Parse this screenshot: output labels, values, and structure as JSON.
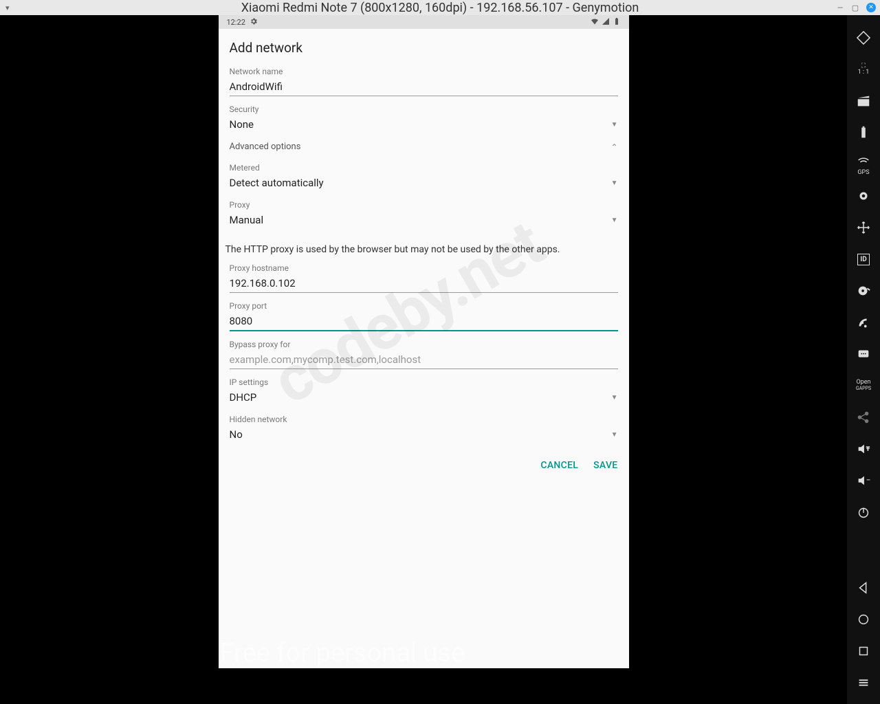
{
  "window": {
    "title": "Xiaomi Redmi Note 7 (800x1280, 160dpi) - 192.168.56.107 - Genymotion"
  },
  "statusbar": {
    "time": "12:22"
  },
  "page": {
    "title": "Add network",
    "network_name_label": "Network name",
    "network_name_value": "AndroidWifi",
    "security_label": "Security",
    "security_value": "None",
    "advanced_label": "Advanced options",
    "metered_label": "Metered",
    "metered_value": "Detect automatically",
    "proxy_label": "Proxy",
    "proxy_value": "Manual",
    "proxy_info": "The HTTP proxy is used by the browser but may not be used by the other apps.",
    "proxy_host_label": "Proxy hostname",
    "proxy_host_value": "192.168.0.102",
    "proxy_port_label": "Proxy port",
    "proxy_port_value": "8080",
    "bypass_label": "Bypass proxy for",
    "bypass_placeholder": "example.com,mycomp.test.com,localhost",
    "ip_label": "IP settings",
    "ip_value": "DHCP",
    "hidden_label": "Hidden network",
    "hidden_value": "No",
    "cancel": "CANCEL",
    "save": "SAVE"
  },
  "watermark": {
    "diag": "codeby.net",
    "bottom": "Free for personal use"
  },
  "toolbar_labels": {
    "gps": "GPS",
    "id": "ID",
    "open": "Open",
    "gapps": "GAPPS",
    "scale": "1 : 1"
  }
}
